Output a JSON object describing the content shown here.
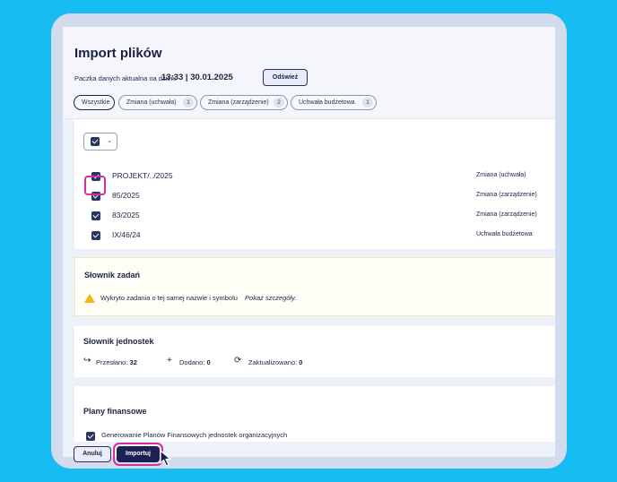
{
  "dialog": {
    "title": "Import plików",
    "date_label": "Paczka danych aktualna na dzień:",
    "date_value": "13:33 | 30.01.2025",
    "refresh_label": "Odśwież"
  },
  "filters": [
    {
      "label": "Wszystkie",
      "count": null,
      "active": true
    },
    {
      "label": "Zmiana (uchwała)",
      "count": "1",
      "active": false
    },
    {
      "label": "Zmiana (zarządzenie)",
      "count": "2",
      "active": false
    },
    {
      "label": "Uchwała budżetowa",
      "count": "1",
      "active": false
    }
  ],
  "files": [
    {
      "name": "PROJEKT/../2025",
      "type": "Zmiana (uchwała)",
      "checked": true
    },
    {
      "name": "85/2025",
      "type": "Zmiana (zarządzenie)",
      "checked": true
    },
    {
      "name": "83/2025",
      "type": "Zmiana (zarządzenie)",
      "checked": true
    },
    {
      "name": "IX/46/24",
      "type": "Uchwała budżetowa",
      "checked": true
    }
  ],
  "task_dictionary": {
    "title": "Słownik zadań",
    "warning": "Wykryto zadania o tej samej nazwie i symbolu",
    "details_link": "Pokaż szczegóły."
  },
  "units_dictionary": {
    "title": "Słownik jednostek",
    "sent_label": "Przesłano:",
    "sent_value": "32",
    "added_label": "Dodano:",
    "added_value": "0",
    "updated_label": "Zaktualizowano:",
    "updated_value": "0"
  },
  "financial_plans": {
    "title": "Plany finansowe",
    "option_label": "Generowanie Planów Finansowych jednostek organizacyjnych",
    "checked": true
  },
  "footer": {
    "cancel_label": "Anuluj",
    "import_label": "Importuj"
  },
  "colors": {
    "background": "#17bdf2",
    "accent": "#1b2152",
    "highlight": "#d62ea0",
    "warning": "#f0b913"
  }
}
